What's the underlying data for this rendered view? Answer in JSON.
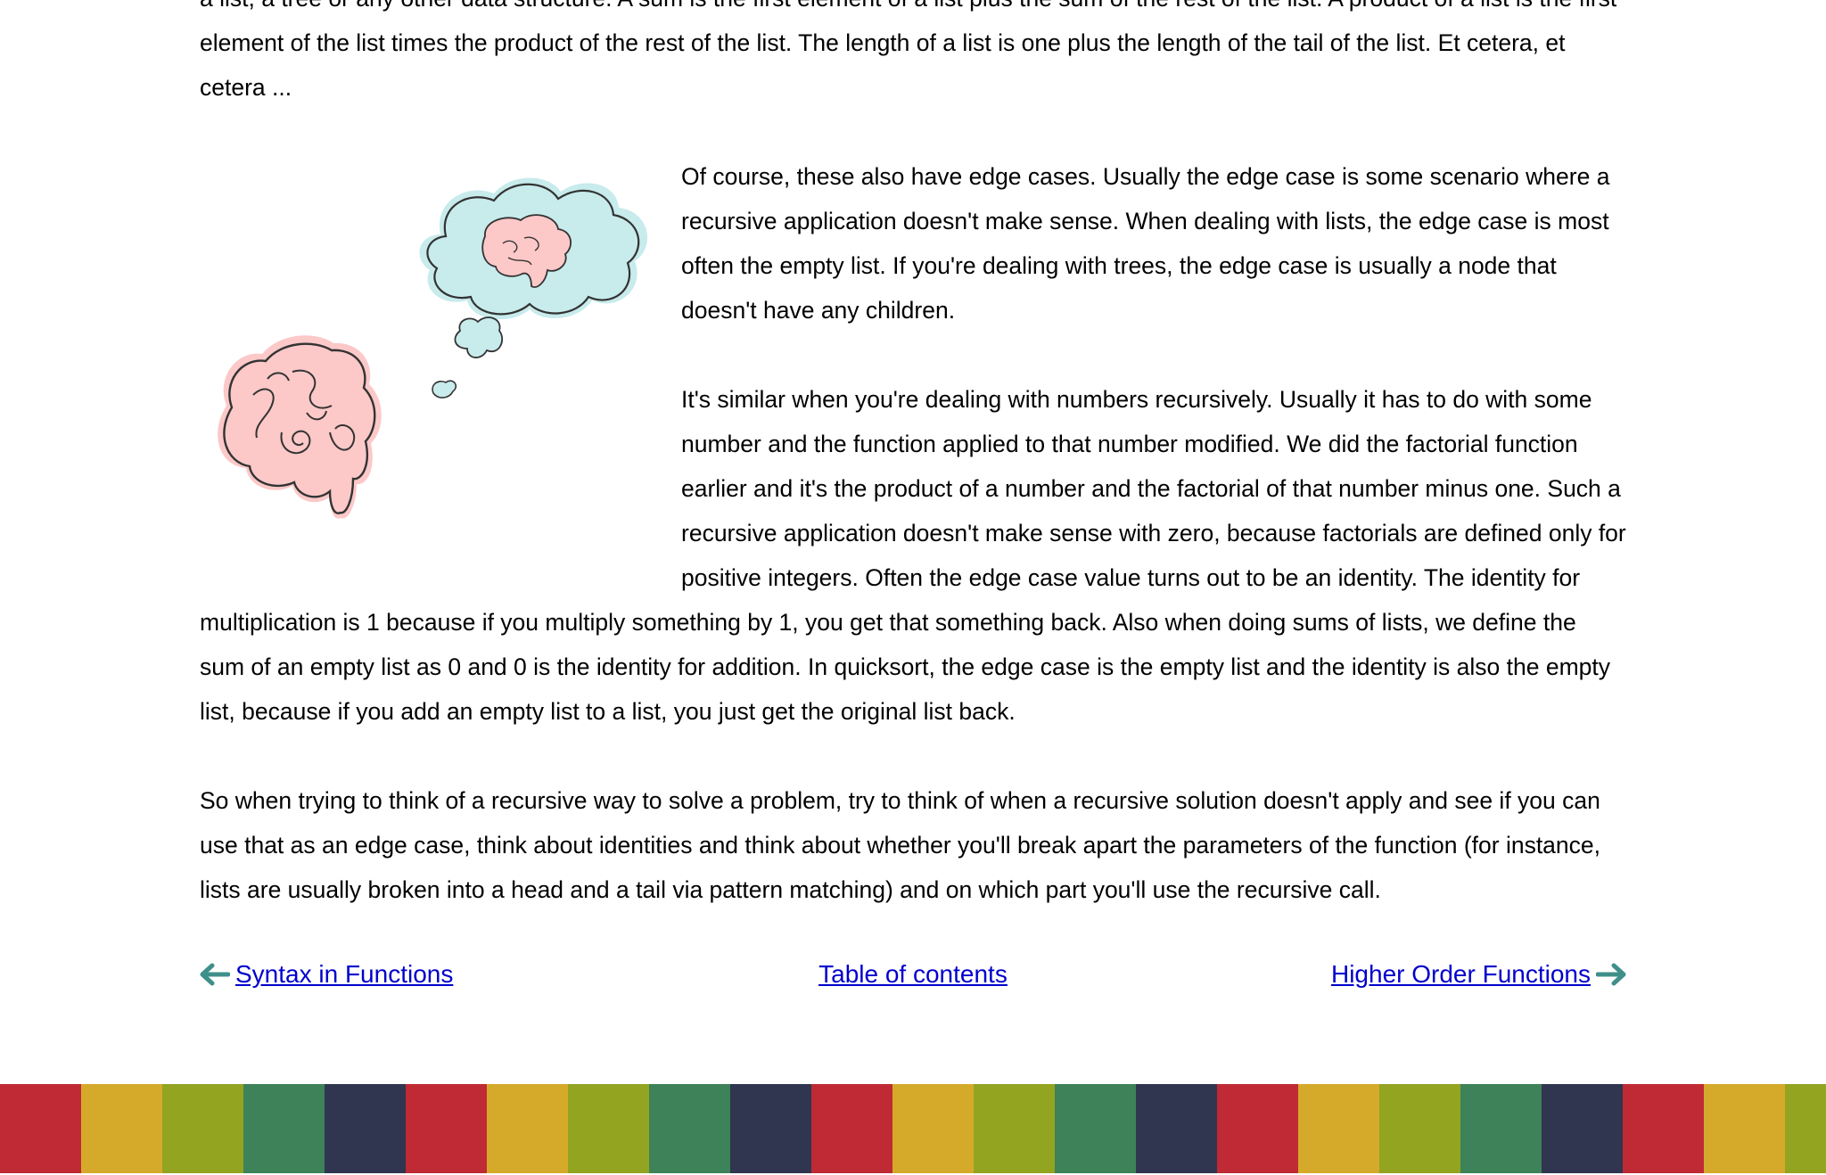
{
  "article": {
    "para_intro": "a list, a tree or any other data structure. A sum is the first element of a list plus the sum of the rest of the list. A product of a list is the first element of the list times the product of the rest of the list. The length of a list is one plus the length of the tail of the list. Et cetera, et cetera ...",
    "para_edge_cases": "Of course, these also have edge cases. Usually the edge case is some scenario where a recursive application doesn't make sense. When dealing with lists, the edge case is most often the empty list. If you're dealing with trees, the edge case is usually a node that doesn't have any children.",
    "para_numbers": "It's similar when you're dealing with numbers recursively. Usually it has to do with some number and the function applied to that number modified. We did the factorial function earlier and it's the product of a number and the factorial of that number minus one. Such a recursive application doesn't make sense with zero, because factorials are defined only for positive integers. Often the edge case value turns out to be an identity. The identity for multiplication is 1 because if you multiply something by 1, you get that something back. Also when doing sums of lists, we define the sum of an empty list as 0 and 0 is the identity for addition. In quicksort, the edge case is the empty list and the identity is also the empty list, because if you add an empty list to a list, you just get the original list back.",
    "para_summary": "So when trying to think of a recursive way to solve a problem, try to think of when a recursive solution doesn't apply and see if you can use that as an edge case, think about identities and think about whether you'll break apart the parameters of the function (for instance, lists are usually broken into a head and a tail via pattern matching) and on which part you'll use the recursive call."
  },
  "nav": {
    "prev_label": "Syntax in Functions",
    "toc_label": "Table of contents",
    "next_label": "Higher Order Functions",
    "prev_icon": "left-arrow-icon",
    "next_icon": "right-arrow-icon"
  },
  "illustration": {
    "icon": "thinking-brain-illustration"
  },
  "colors": {
    "link": "#0000cc",
    "arrow": "#3f8f8a",
    "brain_pink": "#fcc8c8",
    "thought_cloud": "#c8ebec",
    "footer_palette": [
      "#bf2a35",
      "#d5aa2a",
      "#93a421",
      "#3d8258",
      "#30364f"
    ]
  }
}
